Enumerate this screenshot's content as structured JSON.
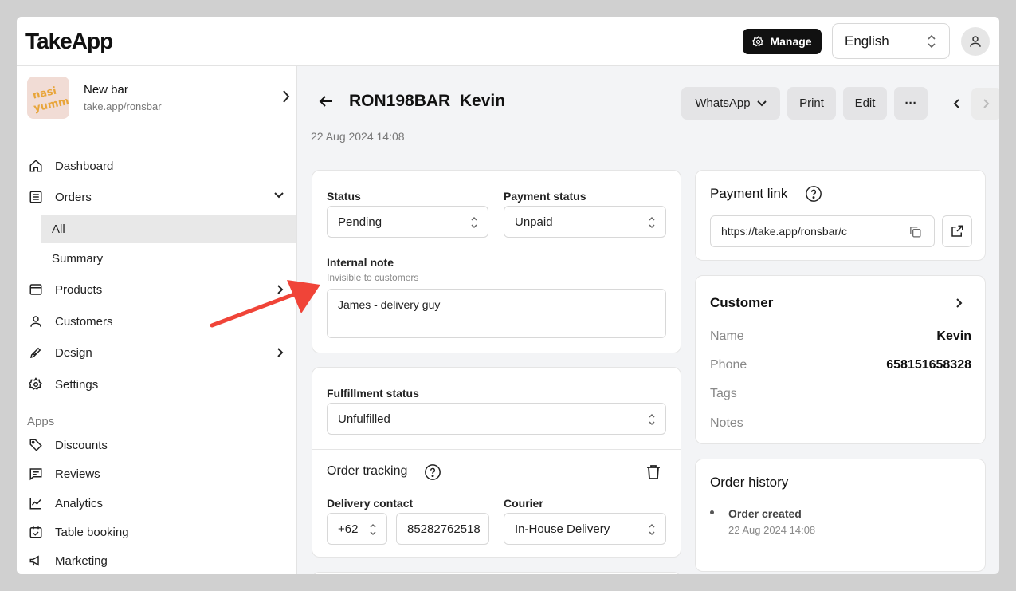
{
  "app": {
    "logo": "TakeApp"
  },
  "topbar": {
    "manage_label": "Manage",
    "language": "English"
  },
  "store": {
    "name": "New bar",
    "url": "take.app/ronsbar",
    "thumb_text": "nasi yumm"
  },
  "sidebar": {
    "dashboard": "Dashboard",
    "orders": "Orders",
    "orders_all": "All",
    "orders_summary": "Summary",
    "products": "Products",
    "customers": "Customers",
    "design": "Design",
    "settings": "Settings",
    "apps_label": "Apps",
    "discounts": "Discounts",
    "reviews": "Reviews",
    "analytics": "Analytics",
    "table_booking": "Table booking",
    "marketing": "Marketing"
  },
  "order": {
    "id": "RON198BAR",
    "customer": "Kevin",
    "date": "22 Aug 2024 14:08",
    "actions": {
      "whatsapp": "WhatsApp",
      "print": "Print",
      "edit": "Edit",
      "more": "···"
    }
  },
  "status_card": {
    "status_label": "Status",
    "status_value": "Pending",
    "payment_label": "Payment status",
    "payment_value": "Unpaid",
    "note_label": "Internal note",
    "note_sub": "Invisible to customers",
    "note_value": "James - delivery guy"
  },
  "fulfillment_card": {
    "label": "Fulfillment status",
    "value": "Unfulfilled",
    "tracking_label": "Order tracking",
    "contact_label": "Delivery contact",
    "country_code": "+62",
    "phone": "85282762518",
    "courier_label": "Courier",
    "courier_value": "In-House Delivery"
  },
  "payment_link": {
    "title": "Payment link",
    "url": "https://take.app/ronsbar/c"
  },
  "customer_card": {
    "title": "Customer",
    "name_label": "Name",
    "name_value": "Kevin",
    "phone_label": "Phone",
    "phone_value": "658151658328",
    "tags_label": "Tags",
    "notes_label": "Notes"
  },
  "history": {
    "title": "Order history",
    "event": "Order created",
    "event_time": "22 Aug 2024 14:08"
  },
  "colors": {
    "annotation_arrow": "#f04438",
    "dark_button": "#111111",
    "surface": "#f3f4f6"
  }
}
